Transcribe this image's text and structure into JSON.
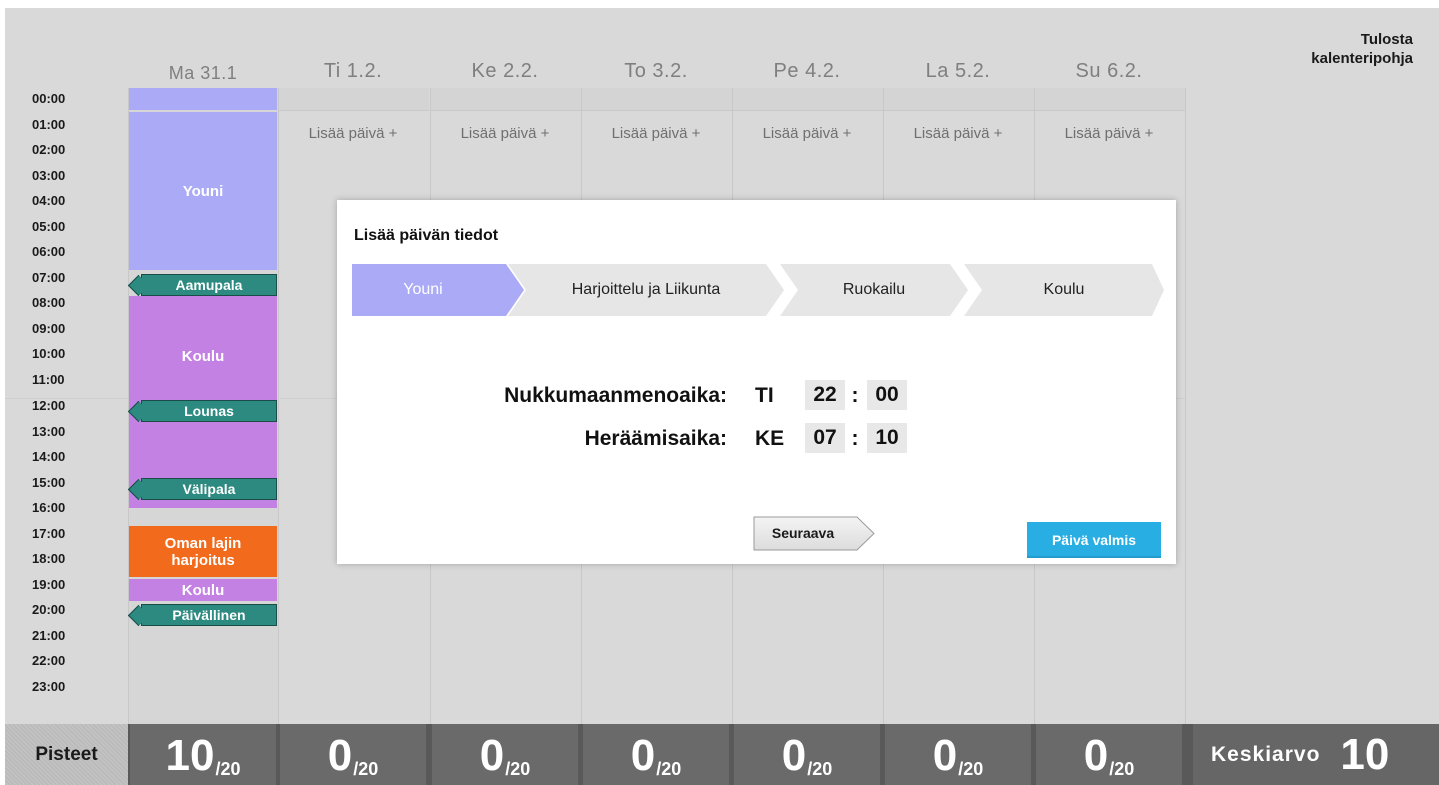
{
  "calendar": {
    "days": [
      {
        "label": "Ma 31.1",
        "add_label": ""
      },
      {
        "label": "Ti 1.2.",
        "add_label": "Lisää päivä +"
      },
      {
        "label": "Ke 2.2.",
        "add_label": "Lisää päivä +"
      },
      {
        "label": "To 3.2.",
        "add_label": "Lisää päivä +"
      },
      {
        "label": "Pe 4.2.",
        "add_label": "Lisää päivä +"
      },
      {
        "label": "La 5.2.",
        "add_label": "Lisää päivä +"
      },
      {
        "label": "Su 6.2.",
        "add_label": "Lisää päivä +"
      }
    ],
    "hours": [
      "00:00",
      "01:00",
      "02:00",
      "03:00",
      "04:00",
      "05:00",
      "06:00",
      "07:00",
      "08:00",
      "09:00",
      "10:00",
      "11:00",
      "12:00",
      "13:00",
      "14:00",
      "15:00",
      "16:00",
      "17:00",
      "18:00",
      "19:00",
      "20:00",
      "21:00",
      "22:00",
      "23:00"
    ],
    "events": {
      "sleep": {
        "label": "Youni",
        "color": "#aaaaf6"
      },
      "school_morning": {
        "label": "Koulu",
        "color": "#c381e4"
      },
      "training": {
        "label": "Oman lajin harjoitus",
        "color": "#f26b1d"
      },
      "school_evening": {
        "label": "Koulu",
        "color": "#c381e4"
      }
    },
    "meals": {
      "breakfast": "Aamupala",
      "lunch": "Lounas",
      "snack": "Välipala",
      "dinner": "Päivällinen"
    }
  },
  "print_link": {
    "line1": "Tulosta",
    "line2": "kalenteripohja"
  },
  "footer": {
    "points_label": "Pisteet",
    "scores": [
      {
        "value": "10",
        "max": "/20"
      },
      {
        "value": "0",
        "max": "/20"
      },
      {
        "value": "0",
        "max": "/20"
      },
      {
        "value": "0",
        "max": "/20"
      },
      {
        "value": "0",
        "max": "/20"
      },
      {
        "value": "0",
        "max": "/20"
      },
      {
        "value": "0",
        "max": "/20"
      }
    ],
    "average_label": "Keskiarvo",
    "average_value": "10"
  },
  "modal": {
    "title": "Lisää päivän tiedot",
    "steps": [
      "Youni",
      "Harjoittelu ja Liikunta",
      "Ruokailu",
      "Koulu"
    ],
    "active_step": 0,
    "bedtime": {
      "label": "Nukkumaanmenoaika:",
      "day": "TI",
      "hour": "22",
      "minute": "00"
    },
    "wakeup": {
      "label": "Heräämisaika:",
      "day": "KE",
      "hour": "07",
      "minute": "10"
    },
    "next_label": "Seuraava",
    "done_label": "Päivä valmis"
  },
  "colors": {
    "accent": "#29aee3",
    "step_active": "#aaaaf6",
    "step_inactive": "#e6e6e6",
    "meal": "#2c8a80"
  }
}
